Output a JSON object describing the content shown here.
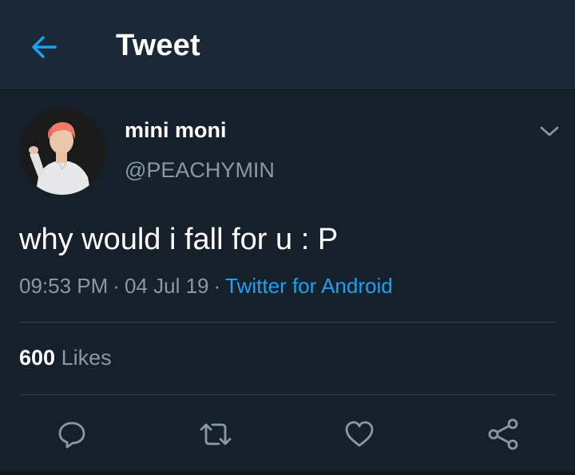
{
  "header": {
    "title": "Tweet",
    "back_icon": "arrow-left-icon"
  },
  "tweet": {
    "author": {
      "display_name": "mini moni",
      "handle": "@PEACHYMIN"
    },
    "text": "why would i fall for u : P",
    "time": "09:53 PM",
    "date": "04 Jul 19",
    "source": "Twitter for Android",
    "likes": {
      "count": "600",
      "label": "Likes"
    }
  },
  "actions": [
    "reply-icon",
    "retweet-icon",
    "like-icon",
    "share-icon"
  ],
  "colors": {
    "background": "#15202b",
    "header": "#1b2836",
    "accent": "#1da1f2",
    "secondary_text": "#8899a6",
    "divider": "#38444d"
  }
}
